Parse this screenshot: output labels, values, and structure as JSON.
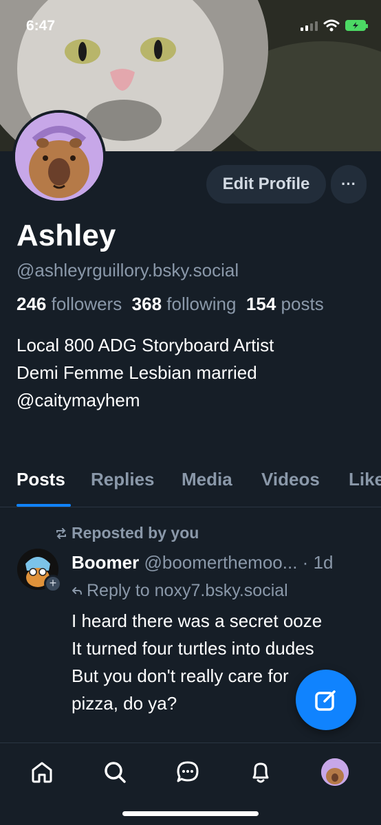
{
  "status_bar": {
    "time": "6:47"
  },
  "profile": {
    "display_name": "Ashley",
    "handle": "@ashleyrguillory.bsky.social",
    "followers_count": "246",
    "followers_label": "followers",
    "following_count": "368",
    "following_label": "following",
    "posts_count": "154",
    "posts_label": "posts",
    "bio": [
      "Local 800 ADG Storyboard Artist",
      "Demi Femme Lesbian married",
      "@caitymayhem"
    ]
  },
  "actions": {
    "edit_profile": "Edit Profile",
    "more": "···"
  },
  "tabs": [
    {
      "label": "Posts",
      "active": true
    },
    {
      "label": "Replies"
    },
    {
      "label": "Media"
    },
    {
      "label": "Videos"
    },
    {
      "label": "Likes"
    }
  ],
  "post": {
    "repost_label": "Reposted by you",
    "author": "Boomer",
    "author_handle": "@boomerthemoo...",
    "separator": "·",
    "age": "1d",
    "reply_to": "Reply to noxy7.bsky.social",
    "text": [
      "I heard there was a secret ooze",
      "It turned four turtles into dudes",
      "But you don't really care for",
      "pizza, do ya?"
    ]
  },
  "colors": {
    "background": "#161e27",
    "accent": "#1083fe",
    "muted": "#8a98a9",
    "button_bg": "#222d3a"
  },
  "icons": {
    "nav": [
      "home-icon",
      "search-icon",
      "chat-icon",
      "bell-icon",
      "avatar"
    ],
    "fab": "compose-icon"
  }
}
